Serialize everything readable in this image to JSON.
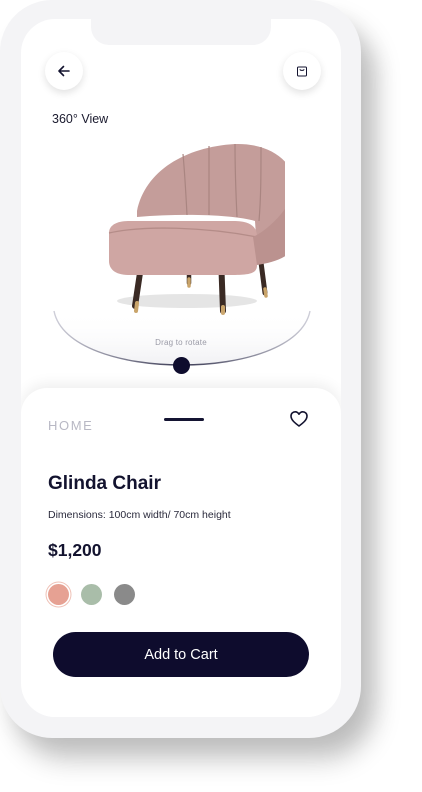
{
  "header": {
    "back_icon": "arrow-left-icon",
    "bag_icon": "shopping-bag-icon",
    "view_label": "360° View"
  },
  "viewer": {
    "drag_hint": "Drag to rotate"
  },
  "product": {
    "category": "HOME",
    "name": "Glinda Chair",
    "dimensions": "Dimensions: 100cm width/ 70cm height",
    "price": "$1,200",
    "favorite_icon": "heart-outline-icon",
    "colors": [
      "#e6a193",
      "#a9bda9",
      "#8a8a8a"
    ],
    "selected_color_index": 0
  },
  "actions": {
    "add_to_cart_label": "Add to Cart"
  },
  "theme": {
    "primary": "#0e0c2d",
    "chair_fabric": "#c9a09d"
  }
}
